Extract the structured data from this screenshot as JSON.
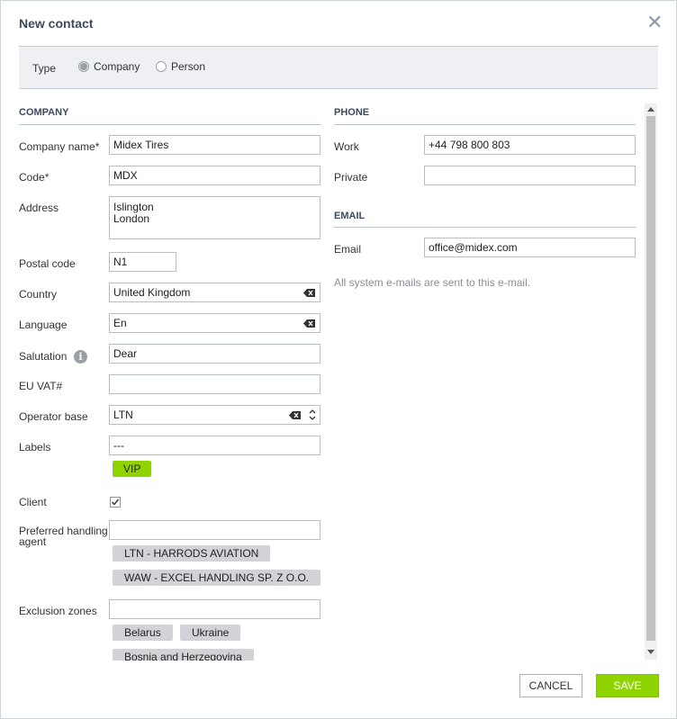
{
  "dialog": {
    "title": "New contact",
    "close_icon": "close-icon"
  },
  "type": {
    "label": "Type",
    "options": [
      {
        "label": "Company",
        "selected": true
      },
      {
        "label": "Person",
        "selected": false
      }
    ]
  },
  "company": {
    "heading": "COMPANY",
    "company_name": {
      "label": "Company name*",
      "value": "Midex Tires"
    },
    "code": {
      "label": "Code*",
      "value": "MDX"
    },
    "address": {
      "label": "Address",
      "value": "Islington\nLondon"
    },
    "postal_code": {
      "label": "Postal code",
      "value": "N1"
    },
    "country": {
      "label": "Country",
      "value": "United Kingdom"
    },
    "language": {
      "label": "Language",
      "value": "En"
    },
    "salutation": {
      "label": "Salutation",
      "value": "Dear",
      "info_icon": "info-icon"
    },
    "eu_vat": {
      "label": "EU VAT#",
      "value": ""
    },
    "operator_base": {
      "label": "Operator base",
      "value": "LTN"
    },
    "labels": {
      "label": "Labels",
      "value": "---",
      "tags": [
        "VIP"
      ]
    },
    "client": {
      "label": "Client",
      "checked": true
    },
    "preferred_handling_agent": {
      "label": "Preferred handling agent",
      "value": "",
      "tags": [
        "LTN - HARRODS AVIATION",
        "WAW - EXCEL HANDLING SP. Z O.O."
      ]
    },
    "exclusion_zones": {
      "label": "Exclusion zones",
      "value": "",
      "tags": [
        "Belarus",
        "Ukraine",
        "Bosnia and Herzegovina"
      ]
    }
  },
  "phone": {
    "heading": "PHONE",
    "work": {
      "label": "Work",
      "value": "+44 798 800 803"
    },
    "private": {
      "label": "Private",
      "value": ""
    }
  },
  "email": {
    "heading": "EMAIL",
    "email": {
      "label": "Email",
      "value": "office@midex.com"
    },
    "hint": "All system e-mails are sent to this e-mail."
  },
  "buttons": {
    "cancel": "CANCEL",
    "save": "SAVE"
  },
  "colors": {
    "accent": "#8fd400",
    "tag_bg": "#d1d3d6",
    "heading": "#3d4a5c"
  }
}
